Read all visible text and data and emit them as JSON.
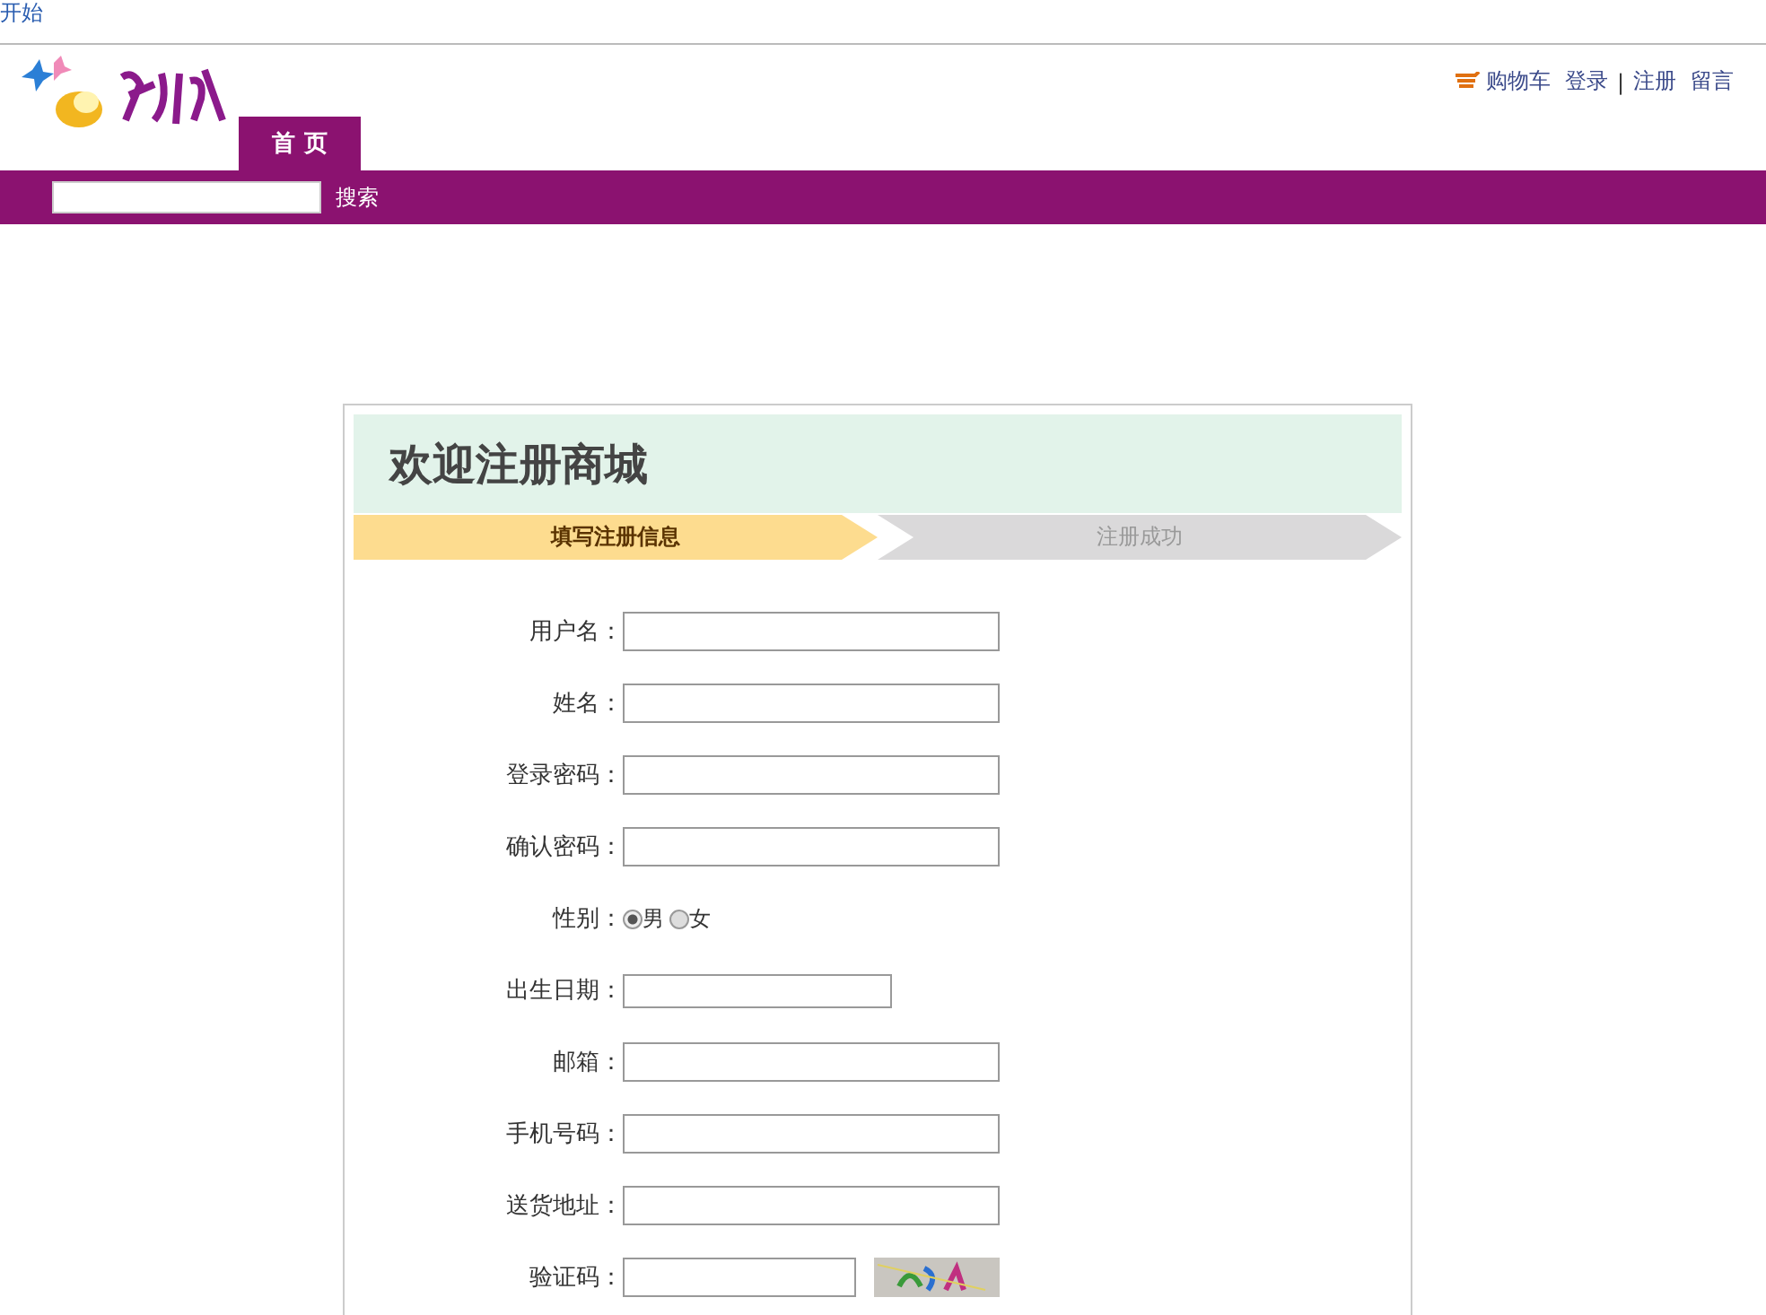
{
  "top_link": "开始",
  "header": {
    "tabs": [
      {
        "label": "首 页",
        "selected": true
      }
    ],
    "links": [
      {
        "label": "购物车",
        "kind": "cart"
      },
      {
        "label": "登录",
        "kind": "link"
      },
      {
        "label": "|",
        "kind": "sep"
      },
      {
        "label": "注册",
        "kind": "link"
      },
      {
        "label": "留言",
        "kind": "link"
      }
    ]
  },
  "search": {
    "button": "搜索"
  },
  "card": {
    "title": "欢迎注册商城",
    "steps": [
      {
        "label": "填写注册信息",
        "selected": true
      },
      {
        "label": "注册成功",
        "selected": false
      }
    ],
    "fields": [
      {
        "label": "用户名：",
        "kind": "text"
      },
      {
        "label": "姓名：",
        "kind": "text"
      },
      {
        "label": "登录密码：",
        "kind": "text"
      },
      {
        "label": "确认密码：",
        "kind": "text"
      },
      {
        "label": "性别：",
        "kind": "radio",
        "options": [
          {
            "label": "男",
            "selected": true
          },
          {
            "label": "女",
            "selected": false
          }
        ]
      },
      {
        "label": "出生日期：",
        "kind": "date"
      },
      {
        "label": "邮箱：",
        "kind": "text"
      },
      {
        "label": "手机号码：",
        "kind": "text"
      },
      {
        "label": "送货地址：",
        "kind": "text"
      },
      {
        "label": "验证码：",
        "kind": "captcha"
      }
    ]
  }
}
